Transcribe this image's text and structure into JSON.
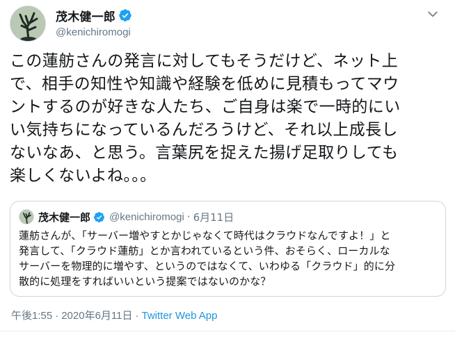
{
  "header": {
    "display_name": "茂木健一郎",
    "handle": "@kenichiromogi"
  },
  "tweet": {
    "text": "この蓮舫さんの発言に対してもそうだけど、ネット上\nで、相手の知性や知識や経験を低めに見積もってマウ\nントするのが好きな人たち、ご自身は楽で一時的にい\nい気持ちになっているんだろうけど、それ以上成長し\nないなあ、と思う。言葉尻を捉えた揚げ足取りしても\n楽しくないよね。。。"
  },
  "quoted": {
    "display_name": "茂木健一郎",
    "handle": "@kenichiromogi",
    "separator": "·",
    "date": "6月11日",
    "text": "蓮舫さんが、「サーバー増やすとかじゃなくて時代はクラウドなんですよ！」と\n発言して、「クラウド蓮舫」とか言われているという件、おそらく、ローカルな\nサーバーを物理的に増やす、というのではなくて、いわゆる「クラウド」的に分\n散的に処理をすればいいという提案ではないのかな？"
  },
  "meta": {
    "time": "午後1:55",
    "separator": "·",
    "date": "2020年6月11日",
    "source": "Twitter Web App"
  },
  "colors": {
    "verified": "#1da1f2",
    "link": "#1b95e0",
    "muted": "#657786",
    "border": "#ccd6dd"
  },
  "icons": {
    "verified": "verified-badge-icon",
    "menu": "chevron-down-icon"
  }
}
